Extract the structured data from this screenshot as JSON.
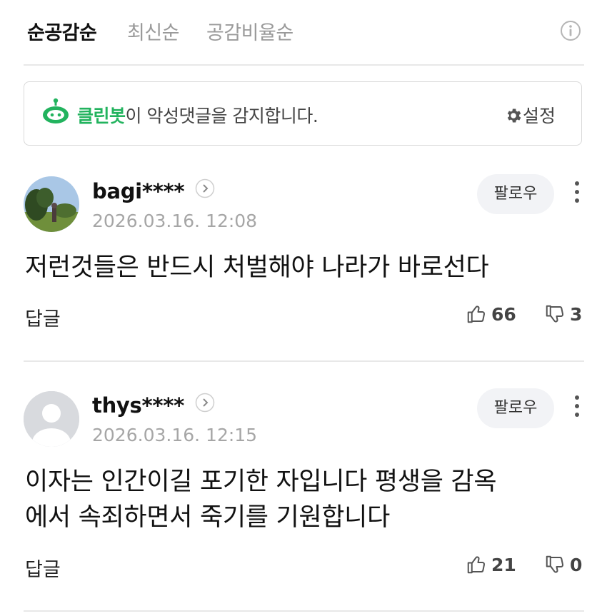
{
  "sort_tabs": [
    {
      "label": "순공감순",
      "active": true
    },
    {
      "label": "최신순",
      "active": false
    },
    {
      "label": "공감비율순",
      "active": false
    }
  ],
  "cleanbot": {
    "name": "클린봇",
    "message": "이 악성댓글을 감지합니다.",
    "settings_label": "설정",
    "brand_color": "#22b35e"
  },
  "comments": [
    {
      "username": "bagi****",
      "timestamp": "2026.03.16. 12:08",
      "follow_label": "팔로우",
      "text_lines": [
        "저런것들은 반드시 처벌해야 나라가 바로선다"
      ],
      "reply_label": "답글",
      "likes": "66",
      "dislikes": "3",
      "avatar": "photo"
    },
    {
      "username": "thys****",
      "timestamp": "2026.03.16. 12:15",
      "follow_label": "팔로우",
      "text_lines": [
        "이자는 인간이길 포기한 자입니다 평생을 감옥",
        "에서 속죄하면서 죽기를 기원합니다"
      ],
      "reply_label": "답글",
      "likes": "21",
      "dislikes": "0",
      "avatar": "default"
    }
  ]
}
